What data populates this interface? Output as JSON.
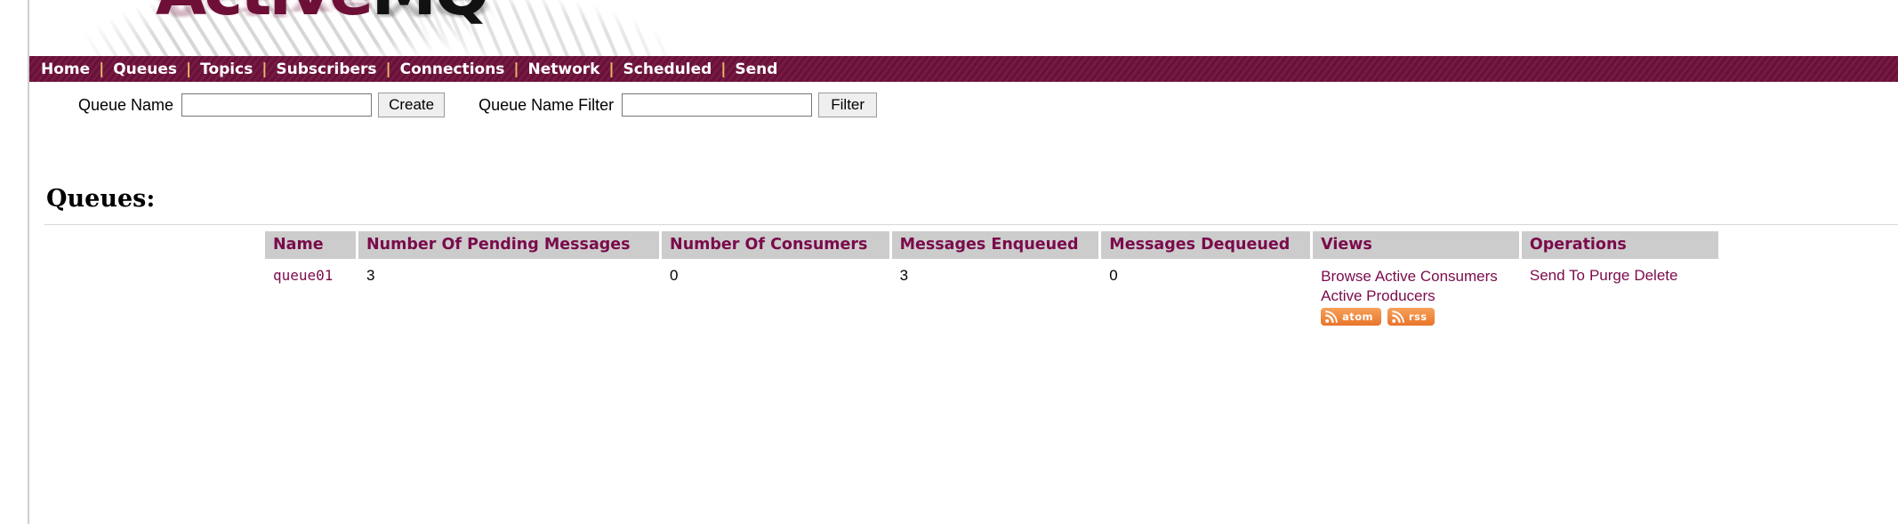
{
  "logo": {
    "part1": "Active",
    "part2": "MQ"
  },
  "nav": {
    "separator": "|",
    "items": [
      {
        "label": "Home"
      },
      {
        "label": "Queues"
      },
      {
        "label": "Topics"
      },
      {
        "label": "Subscribers"
      },
      {
        "label": "Connections"
      },
      {
        "label": "Network"
      },
      {
        "label": "Scheduled"
      },
      {
        "label": "Send"
      }
    ]
  },
  "form": {
    "queue_name_label": "Queue Name",
    "queue_name_value": "",
    "create_button": "Create",
    "queue_name_filter_label": "Queue Name Filter",
    "queue_name_filter_value": "",
    "filter_button": "Filter"
  },
  "main": {
    "heading": "Queues:",
    "table": {
      "columns": [
        "Name",
        "Number Of Pending Messages",
        "Number Of Consumers",
        "Messages Enqueued",
        "Messages Dequeued",
        "Views",
        "Operations"
      ],
      "rows": [
        {
          "name": "queue01",
          "pending": "3",
          "consumers": "0",
          "enqueued": "3",
          "dequeued": "0",
          "views": {
            "browse": "Browse",
            "active_consumers": "Active Consumers",
            "active_producers": "Active Producers",
            "feeds": [
              {
                "label": "atom",
                "icon": "rss-feed-icon"
              },
              {
                "label": "rss",
                "icon": "rss-feed-icon"
              }
            ]
          },
          "operations": {
            "send_to": "Send To",
            "purge": "Purge",
            "delete": "Delete"
          }
        }
      ]
    }
  },
  "colors": {
    "brand_maroon": "#6b0f38",
    "link_maroon": "#7a0b4b",
    "header_cell_bg": "#cccccc",
    "nav_separator": "#e8b86a",
    "feed_orange": "#e8752a"
  }
}
